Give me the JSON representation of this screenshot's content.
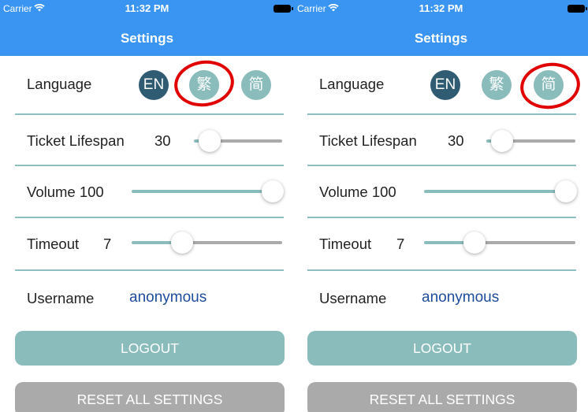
{
  "screens": [
    {
      "status": {
        "carrier": "Carrier",
        "time": "11:32 PM"
      },
      "title": "Settings",
      "language": {
        "label": "Language",
        "options": [
          "EN",
          "繁",
          "简"
        ],
        "active": "EN",
        "highlighted": "繁"
      },
      "ticket_lifespan": {
        "label": "Ticket Lifespan",
        "value": "30",
        "fraction": 0.0
      },
      "volume": {
        "label": "Volume",
        "value": "100",
        "fraction": 1.0
      },
      "timeout": {
        "label": "Timeout",
        "value": "7",
        "fraction": 0.34
      },
      "username": {
        "label": "Username",
        "value": "anonymous"
      },
      "logout_label": "LOGOUT",
      "reset_label": "RESET ALL SETTINGS"
    },
    {
      "status": {
        "carrier": "Carrier",
        "time": "11:32 PM"
      },
      "title": "Settings",
      "language": {
        "label": "Language",
        "options": [
          "EN",
          "繁",
          "简"
        ],
        "active": "EN",
        "highlighted": "简"
      },
      "ticket_lifespan": {
        "label": "Ticket Lifespan",
        "value": "30",
        "fraction": 0.0
      },
      "volume": {
        "label": "Volume",
        "value": "100",
        "fraction": 1.0
      },
      "timeout": {
        "label": "Timeout",
        "value": "7",
        "fraction": 0.34
      },
      "username": {
        "label": "Username",
        "value": "anonymous"
      },
      "logout_label": "LOGOUT",
      "reset_label": "RESET ALL SETTINGS"
    }
  ],
  "colors": {
    "nav_bar": "#3a95f2",
    "accent_teal": "#8bbcbc",
    "active_language": "#2f5c72",
    "separator": "#8fbec0",
    "username_text": "#1d4c9c",
    "reset_button": "#aaaaaa",
    "highlight_circle": "#e00000"
  },
  "icons": {
    "wifi": "wifi-icon",
    "battery": "battery-icon"
  }
}
